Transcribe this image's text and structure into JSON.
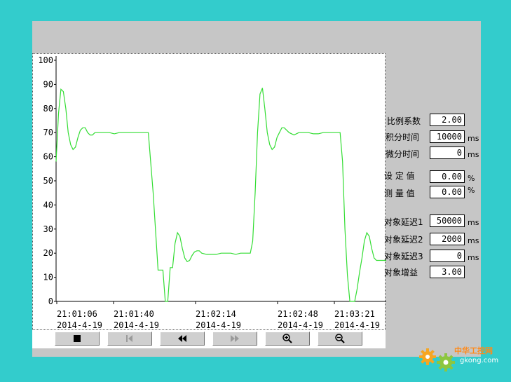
{
  "chart_data": {
    "type": "line",
    "ylim": [
      0,
      100
    ],
    "y_ticks": [
      "100",
      "90",
      "80",
      "70",
      "60",
      "50",
      "40",
      "30",
      "20",
      "10",
      "0"
    ],
    "x_ticks": [
      {
        "time": "21:01:06",
        "date": "2014-4-19"
      },
      {
        "time": "21:01:40",
        "date": "2014-4-19"
      },
      {
        "time": "21:02:14",
        "date": "2014-4-19"
      },
      {
        "time": "21:02:48",
        "date": "2014-4-19"
      },
      {
        "time": "21:03:21",
        "date": "2014-4-19"
      }
    ],
    "line_color": "#33dd33",
    "series": [
      {
        "x_seconds_from_210106": [
          0,
          1,
          2,
          3,
          4,
          5,
          6,
          7,
          8,
          9,
          10,
          11,
          12,
          13,
          14,
          15,
          16,
          17,
          18,
          19,
          20,
          22,
          24,
          26,
          28,
          30,
          32,
          34,
          36,
          38,
          40,
          42,
          44,
          45,
          46,
          47,
          48,
          49,
          50,
          51,
          52,
          53,
          54,
          55,
          56,
          57,
          58,
          59,
          60,
          62,
          64,
          66,
          68,
          70,
          72,
          74,
          76,
          78,
          80,
          81,
          82,
          83,
          84,
          85,
          86,
          87,
          88,
          89,
          90,
          91,
          92,
          93,
          94,
          95,
          96,
          98,
          100,
          102,
          104,
          106,
          108,
          110,
          112,
          114,
          115,
          116,
          117,
          118,
          119,
          120,
          121,
          122,
          123,
          124,
          125,
          126,
          127,
          128,
          129,
          130,
          131,
          132,
          133,
          134,
          135,
          136
        ],
        "values": [
          58,
          78,
          88,
          87,
          80,
          70,
          65,
          63,
          64,
          68,
          71,
          72,
          72,
          70,
          69,
          69,
          70,
          70,
          70,
          70,
          70,
          70,
          69.5,
          70,
          70,
          70,
          70,
          70,
          70,
          70,
          45,
          13,
          13,
          0,
          0,
          14,
          14,
          24,
          28.5,
          27,
          22,
          18,
          16.5,
          17,
          19,
          20.5,
          21,
          21,
          20,
          19.5,
          19.5,
          19.5,
          20,
          20,
          20,
          19.5,
          20,
          20,
          20,
          25,
          45,
          70,
          86,
          88.5,
          80,
          70,
          65,
          63,
          64,
          68,
          70,
          72,
          72,
          71,
          70,
          69,
          70,
          70,
          70,
          69.5,
          69.5,
          70,
          70,
          70,
          70,
          70,
          70,
          58,
          30,
          11,
          0,
          0,
          0,
          5,
          12,
          18,
          25,
          28.5,
          27,
          22,
          18,
          17,
          17,
          17,
          17,
          17,
          17,
          17
        ]
      }
    ]
  },
  "controls": [
    "stop-button",
    "skip-back-button",
    "rewind-button",
    "fast-forward-button",
    "zoom-in-button",
    "zoom-out-button"
  ],
  "params": {
    "kp_label": "比例系数",
    "kp_value": "2.00",
    "ti_label": "积分时间",
    "ti_value": "10000",
    "ti_unit": "ms",
    "td_label": "微分时间",
    "td_value": "0",
    "td_unit": "ms",
    "sp_label": "设 定 值",
    "sp_value": "0.00",
    "sp_unit": "%",
    "pv_label": "测 量 值",
    "pv_value": "0.00",
    "pv_unit": "%",
    "d1_label": "对象延迟1",
    "d1_value": "50000",
    "d1_unit": "ms",
    "d2_label": "对象延迟2",
    "d2_value": "2000",
    "d2_unit": "ms",
    "d3_label": "对象延迟3",
    "d3_value": "0",
    "d3_unit": "ms",
    "gain_label": "对象增益",
    "gain_value": "3.00"
  },
  "watermark": {
    "cn": "中华工控网",
    "url": "gkong.com"
  }
}
